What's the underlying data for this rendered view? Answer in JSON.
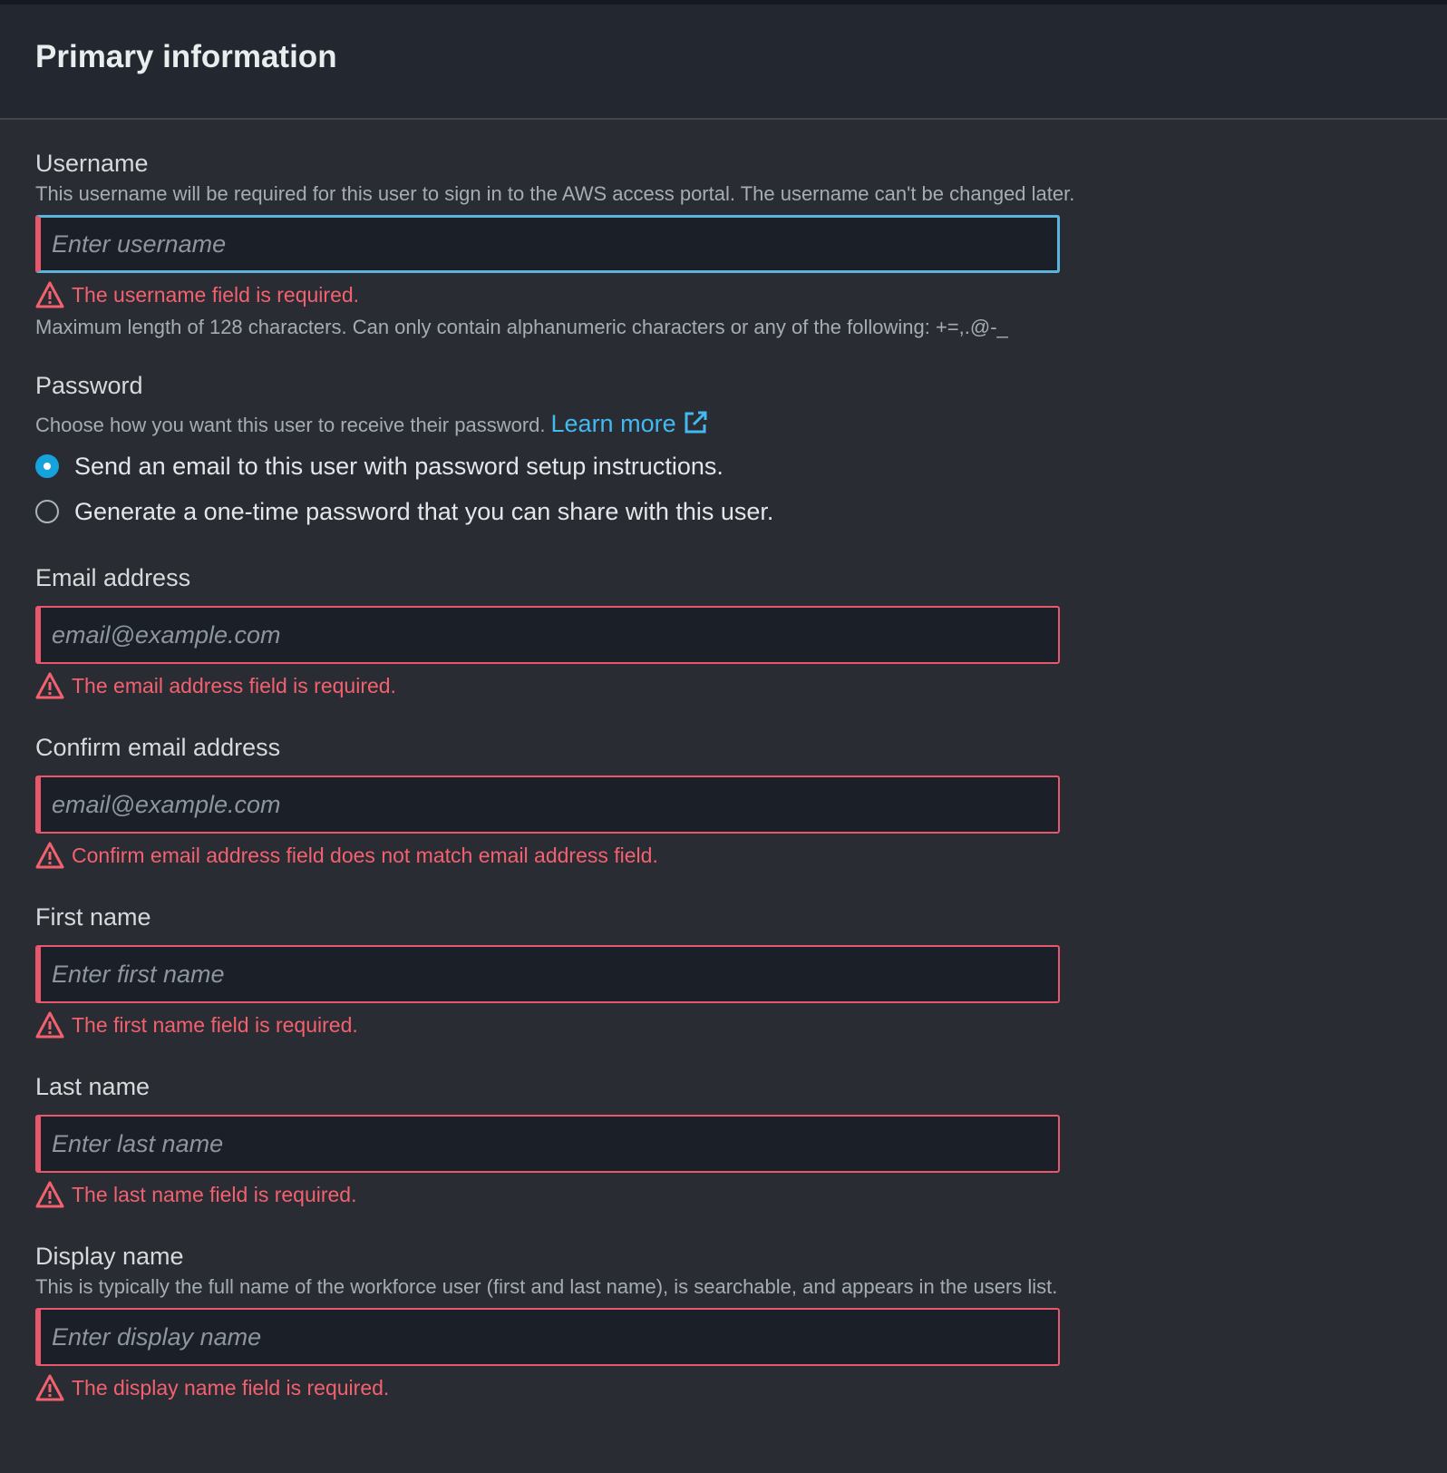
{
  "header": {
    "title": "Primary information"
  },
  "username": {
    "label": "Username",
    "description": "This username will be required for this user to sign in to the AWS access portal. The username can't be changed later.",
    "placeholder": "Enter username",
    "value": "",
    "error": "The username field is required.",
    "constraint": "Maximum length of 128 characters. Can only contain alphanumeric characters or any of the following: +=,.@-_"
  },
  "password": {
    "label": "Password",
    "description": "Choose how you want this user to receive their password.",
    "learn_more": "Learn more",
    "options": [
      {
        "label": "Send an email to this user with password setup instructions.",
        "selected": true
      },
      {
        "label": "Generate a one-time password that you can share with this user.",
        "selected": false
      }
    ]
  },
  "email": {
    "label": "Email address",
    "placeholder": "email@example.com",
    "value": "",
    "error": "The email address field is required."
  },
  "confirm_email": {
    "label": "Confirm email address",
    "placeholder": "email@example.com",
    "value": "",
    "error": "Confirm email address field does not match email address field."
  },
  "first_name": {
    "label": "First name",
    "placeholder": "Enter first name",
    "value": "",
    "error": "The first name field is required."
  },
  "last_name": {
    "label": "Last name",
    "placeholder": "Enter last name",
    "value": "",
    "error": "The last name field is required."
  },
  "display_name": {
    "label": "Display name",
    "description": "This is typically the full name of the workforce user (first and last name), is searchable, and appears in the users list.",
    "placeholder": "Enter display name",
    "value": "",
    "error": "The display name field is required."
  },
  "colors": {
    "background": "#292c33",
    "header_background": "#232730",
    "error": "#f3616f",
    "link": "#44b9f0",
    "focus": "#5ab4dc",
    "radio_selected": "#16a3dc"
  },
  "icons": {
    "warning": "warning-icon",
    "external": "external-link-icon"
  }
}
